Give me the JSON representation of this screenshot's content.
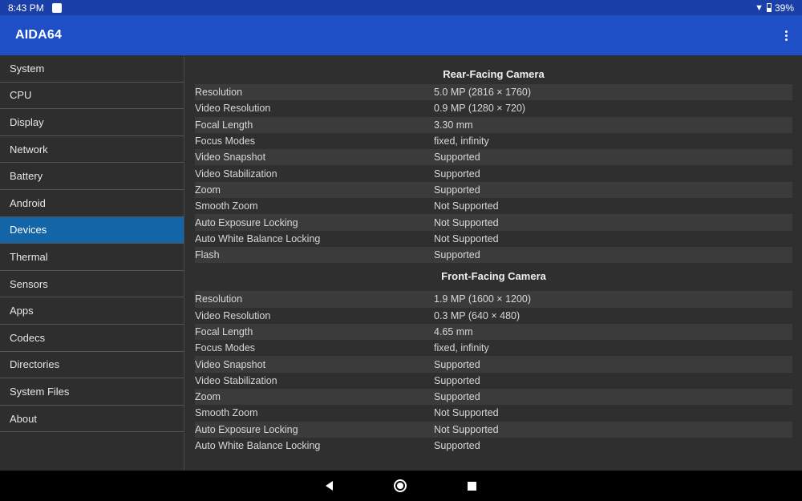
{
  "status_bar": {
    "time": "8:43 PM",
    "battery": "39%"
  },
  "app_bar": {
    "title": "AIDA64"
  },
  "sidebar": {
    "items": [
      {
        "label": "System"
      },
      {
        "label": "CPU"
      },
      {
        "label": "Display"
      },
      {
        "label": "Network"
      },
      {
        "label": "Battery"
      },
      {
        "label": "Android"
      },
      {
        "label": "Devices",
        "active": true
      },
      {
        "label": "Thermal"
      },
      {
        "label": "Sensors"
      },
      {
        "label": "Apps"
      },
      {
        "label": "Codecs"
      },
      {
        "label": "Directories"
      },
      {
        "label": "System Files"
      },
      {
        "label": "About"
      }
    ]
  },
  "rear_camera": {
    "title": "Rear-Facing Camera",
    "rows": [
      {
        "label": "Resolution",
        "value": "5.0 MP (2816 × 1760)"
      },
      {
        "label": "Video Resolution",
        "value": "0.9 MP (1280 × 720)"
      },
      {
        "label": "Focal Length",
        "value": "3.30 mm"
      },
      {
        "label": "Focus Modes",
        "value": "fixed, infinity"
      },
      {
        "label": "Video Snapshot",
        "value": "Supported"
      },
      {
        "label": "Video Stabilization",
        "value": "Supported"
      },
      {
        "label": "Zoom",
        "value": "Supported"
      },
      {
        "label": "Smooth Zoom",
        "value": "Not Supported"
      },
      {
        "label": "Auto Exposure Locking",
        "value": "Not Supported"
      },
      {
        "label": "Auto White Balance Locking",
        "value": "Not Supported"
      },
      {
        "label": "Flash",
        "value": "Supported"
      }
    ]
  },
  "front_camera": {
    "title": "Front-Facing Camera",
    "rows": [
      {
        "label": "Resolution",
        "value": "1.9 MP (1600 × 1200)"
      },
      {
        "label": "Video Resolution",
        "value": "0.3 MP (640 × 480)"
      },
      {
        "label": "Focal Length",
        "value": "4.65 mm"
      },
      {
        "label": "Focus Modes",
        "value": "fixed, infinity"
      },
      {
        "label": "Video Snapshot",
        "value": "Supported"
      },
      {
        "label": "Video Stabilization",
        "value": "Supported"
      },
      {
        "label": "Zoom",
        "value": "Supported"
      },
      {
        "label": "Smooth Zoom",
        "value": "Not Supported"
      },
      {
        "label": "Auto Exposure Locking",
        "value": "Not Supported"
      },
      {
        "label": "Auto White Balance Locking",
        "value": "Supported"
      }
    ]
  },
  "colors": {
    "app_bar": "#1e4fc7",
    "status_bar": "#1a3fa8",
    "active_item": "#1464a8"
  }
}
